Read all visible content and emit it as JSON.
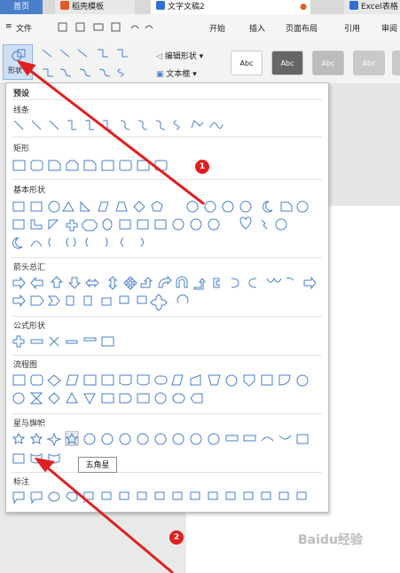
{
  "tabs": [
    "首页",
    "稻壳模板",
    "文字文稿2",
    "Excel表格"
  ],
  "menu": {
    "file_label": "文件",
    "items": [
      "开始",
      "插入",
      "页面布局",
      "引用",
      "审阅"
    ]
  },
  "ribbon": {
    "shape_label": "形状",
    "edit_shape_label": "编辑形状",
    "textbox_label": "文本框",
    "style_label": "Abc"
  },
  "dropdown": {
    "sections": [
      "预设",
      "线条",
      "矩形",
      "基本形状",
      "箭头总汇",
      "公式形状",
      "流程图",
      "星与旗帜",
      "标注"
    ]
  },
  "tooltip": "五角星",
  "annotations": [
    "1",
    "2"
  ],
  "watermark": "Baidu经验",
  "colors": {
    "accent": "#4a7fc9",
    "annotation": "#e02020"
  }
}
